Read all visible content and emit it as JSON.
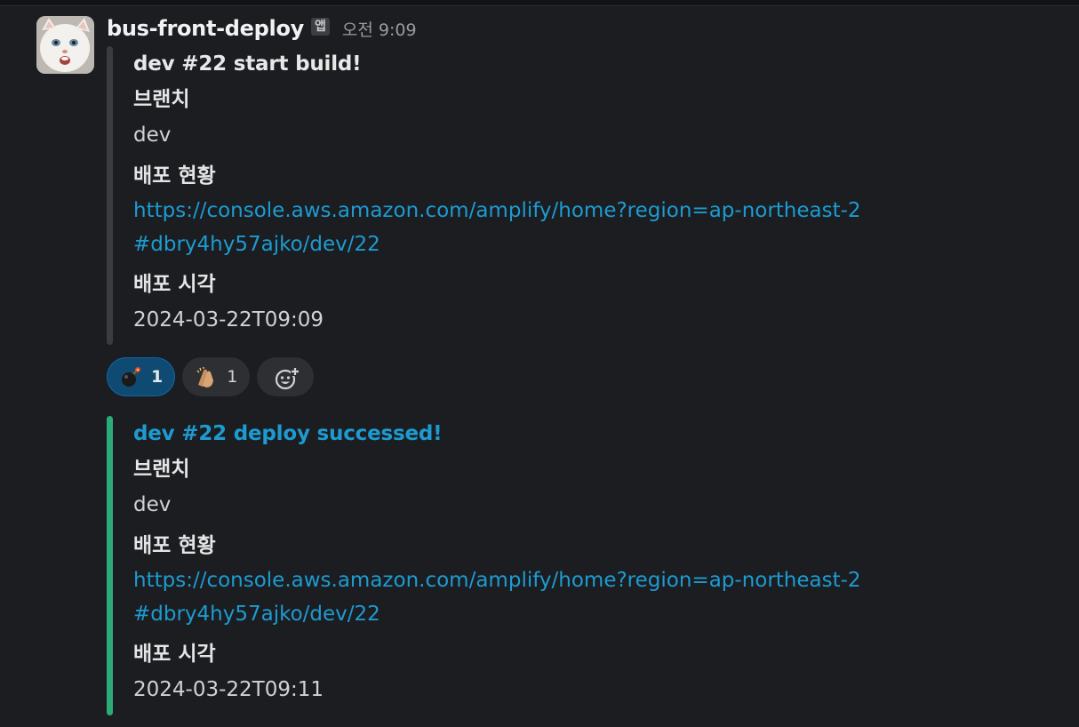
{
  "message": {
    "sender": "bus-front-deploy",
    "app_badge": "앱",
    "timestamp": "오전 9:09"
  },
  "attachments": [
    {
      "title": "dev #22 start build!",
      "fields": {
        "branch_label": "브랜치",
        "branch_value": "dev",
        "status_label": "배포 현황",
        "status_link": "https://console.aws.amazon.com/amplify/home?region=ap-northeast-2#dbry4hy57ajko/dev/22",
        "time_label": "배포 시각",
        "time_value": "2024-03-22T09:09"
      },
      "bar_color": "#3a3c40"
    },
    {
      "title": "dev #22 deploy successed!",
      "fields": {
        "branch_label": "브랜치",
        "branch_value": "dev",
        "status_label": "배포 현황",
        "status_link": "https://console.aws.amazon.com/amplify/home?region=ap-northeast-2#dbry4hy57ajko/dev/22",
        "time_label": "배포 시각",
        "time_value": "2024-03-22T09:11"
      },
      "bar_color": "#2bac76"
    }
  ],
  "reactions": [
    {
      "icon": "bomb-emoji-icon",
      "count": "1",
      "active": true
    },
    {
      "icon": "clapping-hands-emoji-icon",
      "count": "1",
      "active": false
    },
    {
      "icon": "add-reaction-icon"
    }
  ],
  "colors": {
    "background": "#1b1d21",
    "link": "#1d9bd1",
    "success_bar": "#2bac76",
    "active_reaction": "#0f4a73"
  }
}
